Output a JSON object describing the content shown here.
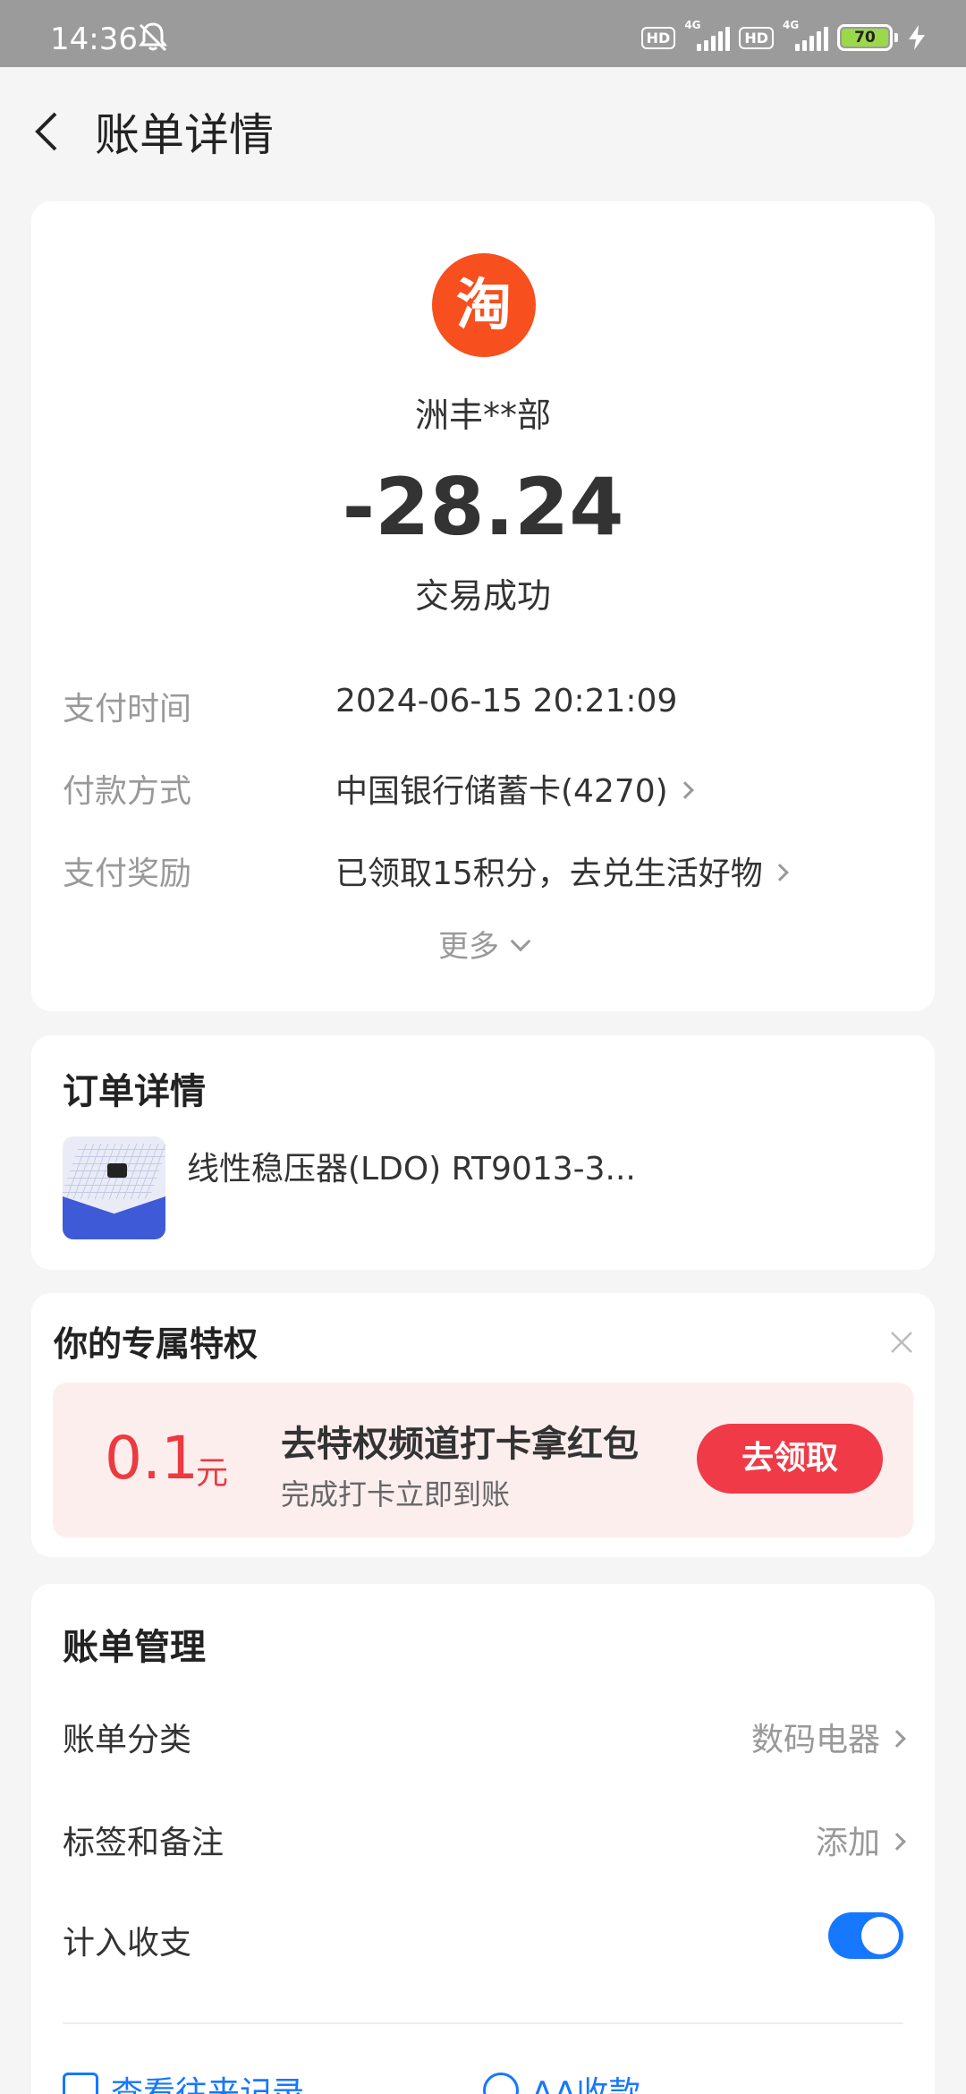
{
  "status_bar": {
    "time": "14:36",
    "hd1": "HD",
    "net1": "4G",
    "hd2": "HD",
    "net2": "4G",
    "battery": "70"
  },
  "nav": {
    "title": "账单详情"
  },
  "summary": {
    "logo_text": "淘",
    "merchant": "洲丰**部",
    "amount": "-28.24",
    "status": "交易成功",
    "rows": [
      {
        "label": "支付时间",
        "value": "2024-06-15 20:21:09"
      },
      {
        "label": "付款方式",
        "value": "中国银行储蓄卡(4270)"
      },
      {
        "label": "支付奖励",
        "value": "已领取15积分，去兑生活好物"
      }
    ],
    "more": "更多"
  },
  "order": {
    "title": "订单详情",
    "product": "线性稳压器(LDO) RT9013-3..."
  },
  "privilege": {
    "title": "你的专属特权",
    "amount": "0.1",
    "unit": "元",
    "headline": "去特权频道打卡拿红包",
    "sub": "完成打卡立即到账",
    "button": "去领取"
  },
  "bill_manage": {
    "title": "账单管理",
    "category_label": "账单分类",
    "category_value": "数码电器",
    "tag_label": "标签和备注",
    "tag_value": "添加",
    "include_label": "计入收支",
    "include_on": true,
    "link1": "查看往来记录",
    "link2": "AA收款"
  },
  "colors": {
    "accent": "#1677ff",
    "red": "#ec3a3f",
    "taobao": "#f74f1d"
  }
}
